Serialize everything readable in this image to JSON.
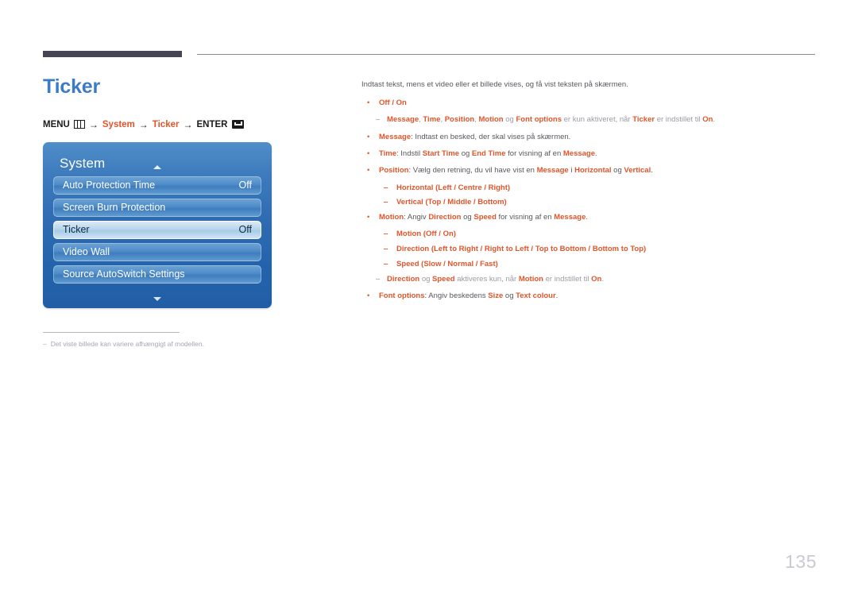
{
  "page": {
    "title": "Ticker",
    "number": "135",
    "menu_path": {
      "menu_label": "MENU",
      "menu_icon": "menu-grid-icon",
      "arrow": "→",
      "step1": "System",
      "step2": "Ticker",
      "enter_label": "ENTER",
      "enter_icon": "enter-return-icon"
    }
  },
  "osd": {
    "title": "System",
    "caret_up_icon": "caret-up-icon",
    "caret_down_icon": "caret-down-icon",
    "rows": [
      {
        "label": "Auto Protection Time",
        "value": "Off",
        "selected": false
      },
      {
        "label": "Screen Burn Protection",
        "value": "",
        "selected": false
      },
      {
        "label": "Ticker",
        "value": "Off",
        "selected": true
      },
      {
        "label": "Video Wall",
        "value": "",
        "selected": false
      },
      {
        "label": "Source AutoSwitch Settings",
        "value": "",
        "selected": false
      }
    ]
  },
  "footnote": {
    "dash": "‒",
    "text": "Det viste billede kan variere afhængigt af modellen."
  },
  "content": {
    "intro": "Indtast tekst, mens et video eller et billede vises, og få vist teksten på skærmen.",
    "bullet": "•",
    "dash": "‒",
    "items": [
      {
        "marker": "bullet",
        "level": "top",
        "parts": [
          {
            "t": "Off",
            "s": "k"
          },
          {
            "t": " / ",
            "s": "k"
          },
          {
            "t": "On",
            "s": "k"
          }
        ]
      },
      {
        "marker": "note",
        "level": "note",
        "parts": [
          {
            "t": "Message",
            "s": "k"
          },
          {
            "t": ", ",
            "s": "gl"
          },
          {
            "t": "Time",
            "s": "k"
          },
          {
            "t": ", ",
            "s": "gl"
          },
          {
            "t": "Position",
            "s": "k"
          },
          {
            "t": ", ",
            "s": "gl"
          },
          {
            "t": "Motion",
            "s": "k"
          },
          {
            "t": " og ",
            "s": "gl"
          },
          {
            "t": "Font options",
            "s": "k"
          },
          {
            "t": " er kun aktiveret, når ",
            "s": "gl"
          },
          {
            "t": "Ticker",
            "s": "k"
          },
          {
            "t": " er indstillet til ",
            "s": "gl"
          },
          {
            "t": "On",
            "s": "k"
          },
          {
            "t": ".",
            "s": "gl"
          }
        ]
      },
      {
        "marker": "bullet",
        "level": "top",
        "parts": [
          {
            "t": "Message",
            "s": "k"
          },
          {
            "t": ": Indtast en besked, der skal vises på skærmen.",
            "s": "g"
          }
        ]
      },
      {
        "marker": "bullet",
        "level": "top",
        "parts": [
          {
            "t": "Time",
            "s": "k"
          },
          {
            "t": ": Indstil ",
            "s": "g"
          },
          {
            "t": "Start Time",
            "s": "k"
          },
          {
            "t": " og ",
            "s": "g"
          },
          {
            "t": "End Time",
            "s": "k"
          },
          {
            "t": " for visning af en ",
            "s": "g"
          },
          {
            "t": "Message",
            "s": "k"
          },
          {
            "t": ".",
            "s": "g"
          }
        ]
      },
      {
        "marker": "bullet",
        "level": "top",
        "parts": [
          {
            "t": "Position",
            "s": "k"
          },
          {
            "t": ": Vælg den retning, du vil have vist en ",
            "s": "g"
          },
          {
            "t": "Message",
            "s": "k"
          },
          {
            "t": " i ",
            "s": "g"
          },
          {
            "t": "Horizontal",
            "s": "k"
          },
          {
            "t": " og ",
            "s": "g"
          },
          {
            "t": "Vertical",
            "s": "k"
          },
          {
            "t": ".",
            "s": "g"
          }
        ]
      },
      {
        "marker": "dash",
        "level": "sub",
        "parts": [
          {
            "t": "Horizontal",
            "s": "k"
          },
          {
            "t": " (",
            "s": "k"
          },
          {
            "t": "Left",
            "s": "k"
          },
          {
            "t": " / ",
            "s": "k"
          },
          {
            "t": "Centre",
            "s": "k"
          },
          {
            "t": " / ",
            "s": "k"
          },
          {
            "t": "Right",
            "s": "k"
          },
          {
            "t": ")",
            "s": "k"
          }
        ]
      },
      {
        "marker": "dash",
        "level": "sub",
        "parts": [
          {
            "t": "Vertical",
            "s": "k"
          },
          {
            "t": " (",
            "s": "k"
          },
          {
            "t": "Top",
            "s": "k"
          },
          {
            "t": " / ",
            "s": "k"
          },
          {
            "t": "Middle",
            "s": "k"
          },
          {
            "t": " / ",
            "s": "k"
          },
          {
            "t": "Bottom",
            "s": "k"
          },
          {
            "t": ")",
            "s": "k"
          }
        ]
      },
      {
        "marker": "bullet",
        "level": "top",
        "parts": [
          {
            "t": "Motion",
            "s": "k"
          },
          {
            "t": ": Angiv ",
            "s": "g"
          },
          {
            "t": "Direction",
            "s": "k"
          },
          {
            "t": " og ",
            "s": "g"
          },
          {
            "t": "Speed",
            "s": "k"
          },
          {
            "t": " for visning af en ",
            "s": "g"
          },
          {
            "t": "Message",
            "s": "k"
          },
          {
            "t": ".",
            "s": "g"
          }
        ]
      },
      {
        "marker": "dash",
        "level": "sub",
        "parts": [
          {
            "t": "Motion",
            "s": "k"
          },
          {
            "t": " (",
            "s": "k"
          },
          {
            "t": "Off",
            "s": "k"
          },
          {
            "t": " / ",
            "s": "k"
          },
          {
            "t": "On",
            "s": "k"
          },
          {
            "t": ")",
            "s": "k"
          }
        ]
      },
      {
        "marker": "dash",
        "level": "sub",
        "parts": [
          {
            "t": "Direction",
            "s": "k"
          },
          {
            "t": " (",
            "s": "k"
          },
          {
            "t": "Left to Right",
            "s": "k"
          },
          {
            "t": " / ",
            "s": "k"
          },
          {
            "t": "Right to Left",
            "s": "k"
          },
          {
            "t": " / ",
            "s": "k"
          },
          {
            "t": "Top to Bottom",
            "s": "k"
          },
          {
            "t": " / ",
            "s": "k"
          },
          {
            "t": "Bottom to Top",
            "s": "k"
          },
          {
            "t": ")",
            "s": "k"
          }
        ]
      },
      {
        "marker": "dash",
        "level": "sub",
        "parts": [
          {
            "t": "Speed",
            "s": "k"
          },
          {
            "t": " (",
            "s": "k"
          },
          {
            "t": "Slow",
            "s": "k"
          },
          {
            "t": " / ",
            "s": "k"
          },
          {
            "t": "Normal",
            "s": "k"
          },
          {
            "t": " / ",
            "s": "k"
          },
          {
            "t": "Fast",
            "s": "k"
          },
          {
            "t": ")",
            "s": "k"
          }
        ]
      },
      {
        "marker": "note",
        "level": "note",
        "parts": [
          {
            "t": "Direction",
            "s": "k"
          },
          {
            "t": " og ",
            "s": "gl"
          },
          {
            "t": "Speed",
            "s": "k"
          },
          {
            "t": " aktiveres kun, når ",
            "s": "gl"
          },
          {
            "t": "Motion",
            "s": "k"
          },
          {
            "t": " er indstillet til ",
            "s": "gl"
          },
          {
            "t": "On",
            "s": "k"
          },
          {
            "t": ".",
            "s": "gl"
          }
        ]
      },
      {
        "marker": "bullet",
        "level": "top",
        "parts": [
          {
            "t": "Font options",
            "s": "k"
          },
          {
            "t": ": Angiv beskedens ",
            "s": "g"
          },
          {
            "t": "Size",
            "s": "k"
          },
          {
            "t": " og ",
            "s": "g"
          },
          {
            "t": "Text colour",
            "s": "k"
          },
          {
            "t": ".",
            "s": "g"
          }
        ]
      }
    ]
  }
}
